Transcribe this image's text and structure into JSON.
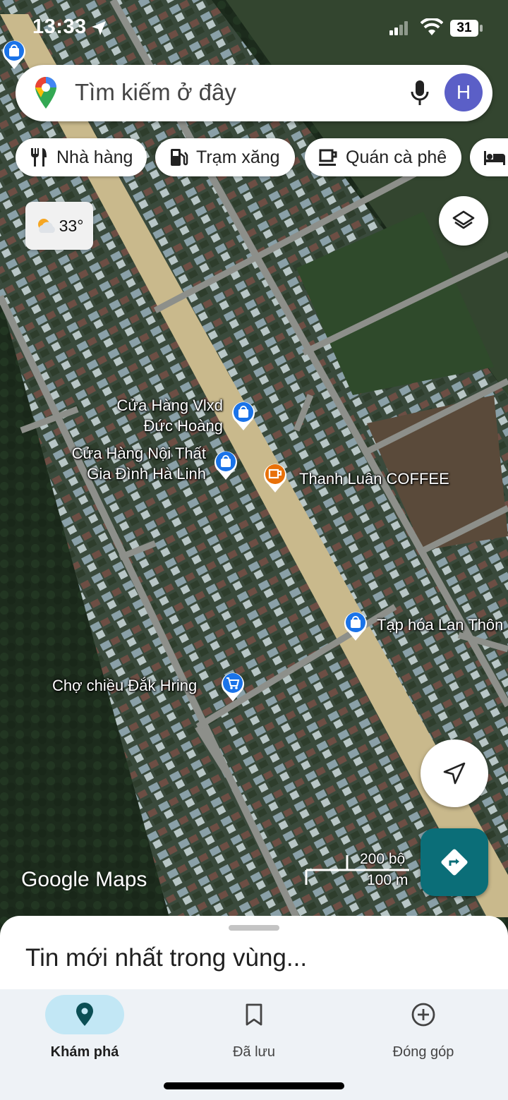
{
  "status_bar": {
    "time": "13:33",
    "battery": "31"
  },
  "search": {
    "placeholder": "Tìm kiếm ở đây",
    "avatar_initial": "H"
  },
  "chips": [
    {
      "label": "Nhà hàng",
      "icon": "restaurant-icon"
    },
    {
      "label": "Trạm xăng",
      "icon": "gas-station-icon"
    },
    {
      "label": "Quán cà phê",
      "icon": "coffee-icon"
    },
    {
      "label": "",
      "icon": "hotel-icon"
    }
  ],
  "weather": {
    "temp": "33°",
    "icon": "partly-cloudy-icon"
  },
  "places": [
    {
      "name_line1": "Cửa Hàng Vlxd",
      "name_line2": "Đức Hoàng",
      "icon": "shopping-bag-icon",
      "color": "#1a73e8"
    },
    {
      "name_line1": "Cửa Hàng Nội Thất",
      "name_line2": "Gia Đình Hà Linh",
      "icon": "shopping-bag-icon",
      "color": "#1a73e8"
    },
    {
      "name_line1": "Thanh Luân COFFEE",
      "icon": "coffee-icon",
      "color": "#e8710a"
    },
    {
      "name_line1": "Tạp hóa Lan Thôn",
      "icon": "shopping-bag-icon",
      "color": "#1a73e8"
    },
    {
      "name_line1": "Chợ chiều Đắk Hring",
      "icon": "cart-icon",
      "color": "#1a73e8"
    }
  ],
  "map": {
    "attribution": "Google Maps",
    "scale_imperial": "200 bộ",
    "scale_metric": "100 m"
  },
  "sheet": {
    "title": "Tin mới nhất trong vùng..."
  },
  "nav": [
    {
      "label": "Khám phá",
      "icon": "location-pin-icon",
      "active": true
    },
    {
      "label": "Đã lưu",
      "icon": "bookmark-icon",
      "active": false
    },
    {
      "label": "Đóng góp",
      "icon": "add-circle-icon",
      "active": false
    }
  ],
  "colors": {
    "accent": "#0b6e78",
    "nav_active_bg": "#c2e7f5",
    "poi_blue": "#1a73e8",
    "poi_orange": "#e8710a"
  }
}
